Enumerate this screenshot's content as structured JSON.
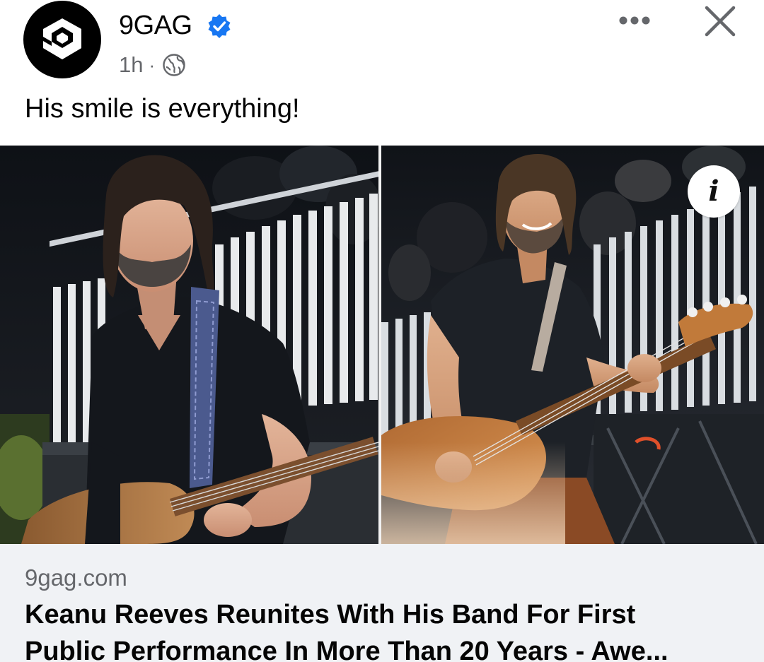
{
  "header": {
    "page_name": "9GAG",
    "time": "1h",
    "separator": "·",
    "audience_icon": "globe-icon",
    "verified_icon": "verified-badge-icon",
    "more_icon": "more-horizontal-icon",
    "close_icon": "close-icon",
    "verified_color": "#1877f2"
  },
  "post": {
    "caption": "His smile is everything!"
  },
  "media": {
    "info_label": "i"
  },
  "link_preview": {
    "domain": "9gag.com",
    "title_line1": "Keanu Reeves Reunites With His Band For First",
    "title_line2": "Public Performance In More Than 20 Years - Awe..."
  }
}
